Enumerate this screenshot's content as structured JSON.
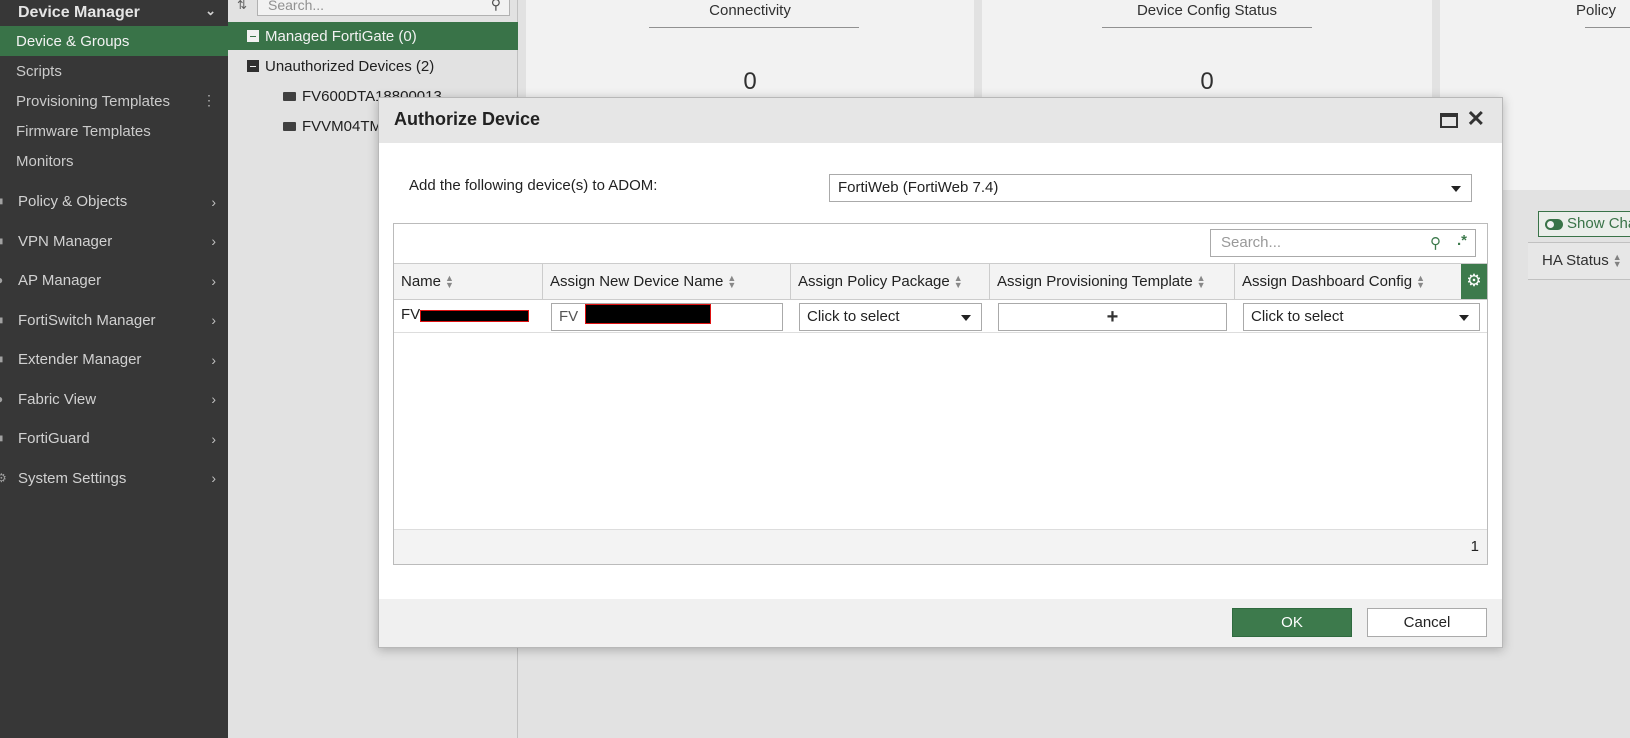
{
  "sidebar": {
    "header": "Device Manager",
    "subitems": [
      "Device & Groups",
      "Scripts",
      "Provisioning Templates",
      "Firmware Templates",
      "Monitors"
    ],
    "items": [
      "Policy & Objects",
      "VPN Manager",
      "AP Manager",
      "FortiSwitch Manager",
      "Extender Manager",
      "Fabric View",
      "FortiGuard",
      "System Settings"
    ]
  },
  "tree": {
    "search_placeholder": "Search...",
    "managed": "Managed FortiGate (0)",
    "unauthorized": "Unauthorized Devices (2)",
    "devices": [
      "FV600DTA18800013",
      "FVVM04TM"
    ]
  },
  "dashboard": {
    "cards": [
      {
        "title": "Connectivity",
        "value": "0"
      },
      {
        "title": "Device Config Status",
        "value": "0"
      },
      {
        "title": "Policy",
        "value": ""
      }
    ],
    "show_button": "Show Cha",
    "ha_status": "HA Status"
  },
  "dialog": {
    "title": "Authorize Device",
    "adom_label": "Add the following device(s) to ADOM:",
    "adom_value": "FortiWeb (FortiWeb 7.4)",
    "search_placeholder": "Search...",
    "columns": [
      "Name",
      "Assign New Device Name",
      "Assign Policy Package",
      "Assign Provisioning Template",
      "Assign Dashboard Config"
    ],
    "row": {
      "name_prefix": "FV",
      "new_name_prefix": "FV",
      "policy_package": "Click to select",
      "dashboard_config": "Click to select"
    },
    "row_count": "1",
    "ok": "OK",
    "cancel": "Cancel"
  }
}
